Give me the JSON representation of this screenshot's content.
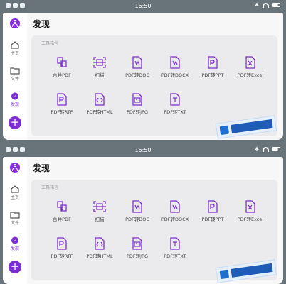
{
  "status_bar": {
    "time": "16:50"
  },
  "nav": {
    "home_label": "主页",
    "files_label": "文件",
    "discover_label": "发现",
    "fab_symbol": "+"
  },
  "page": {
    "title": "发现"
  },
  "section": {
    "label": "工具箱包"
  },
  "tools": [
    {
      "label": "合并PDF",
      "icon": "merge-pdf-icon"
    },
    {
      "label": "扫描",
      "icon": "scan-icon"
    },
    {
      "label": "PDF转DOC",
      "icon": "pdf-to-doc-icon"
    },
    {
      "label": "PDF转DOCX",
      "icon": "pdf-to-docx-icon"
    },
    {
      "label": "PDF转PPT",
      "icon": "pdf-to-ppt-icon"
    },
    {
      "label": "PDF转Excel",
      "icon": "pdf-to-excel-icon"
    },
    {
      "label": "PDF转RTF",
      "icon": "pdf-to-rtf-icon"
    },
    {
      "label": "PDF转HTML",
      "icon": "pdf-to-html-icon"
    },
    {
      "label": "PDF转JPG",
      "icon": "pdf-to-jpg-icon"
    },
    {
      "label": "PDF转TXT",
      "icon": "pdf-to-txt-icon"
    }
  ],
  "colors": {
    "accent": "#7b2fd0",
    "panel": "#ebebed",
    "frame": "#68737a"
  }
}
